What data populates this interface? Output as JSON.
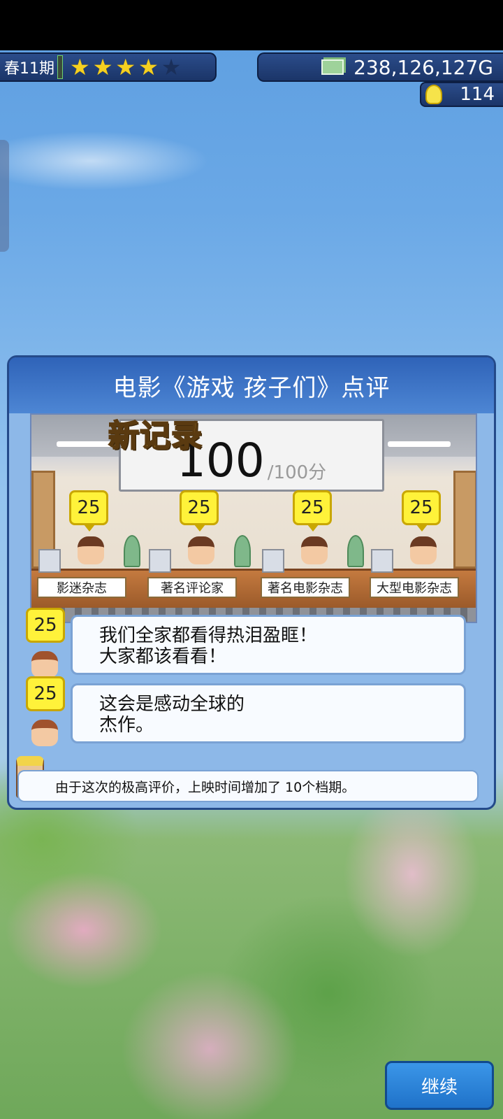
{
  "hud": {
    "season": "春11期",
    "stars_filled": 4,
    "stars_total": 5,
    "money": "238,126,127G",
    "ideas": "114"
  },
  "review": {
    "title": "电影《游戏 孩子们》点评",
    "new_record": "新记录",
    "score": "100",
    "score_max": "/100分",
    "judges": [
      {
        "score": "25",
        "name": "影迷杂志"
      },
      {
        "score": "25",
        "name": "著名评论家"
      },
      {
        "score": "25",
        "name": "著名电影杂志"
      },
      {
        "score": "25",
        "name": "大型电影杂志"
      }
    ],
    "comments": [
      {
        "score": "25",
        "text": "我们全家都看得热泪盈眶！\n大家都该看看！"
      },
      {
        "score": "25",
        "text": "这会是感动全球的\n杰作。"
      }
    ],
    "footer": "由于这次的极高评价，上映时间增加了 10个档期。"
  },
  "buttons": {
    "continue": "继续"
  },
  "colors": {
    "star_on": "#f5d020",
    "score_bubble": "#fff23a",
    "title_bar": "#2f63b8",
    "continue_button": "#2b84d8"
  }
}
